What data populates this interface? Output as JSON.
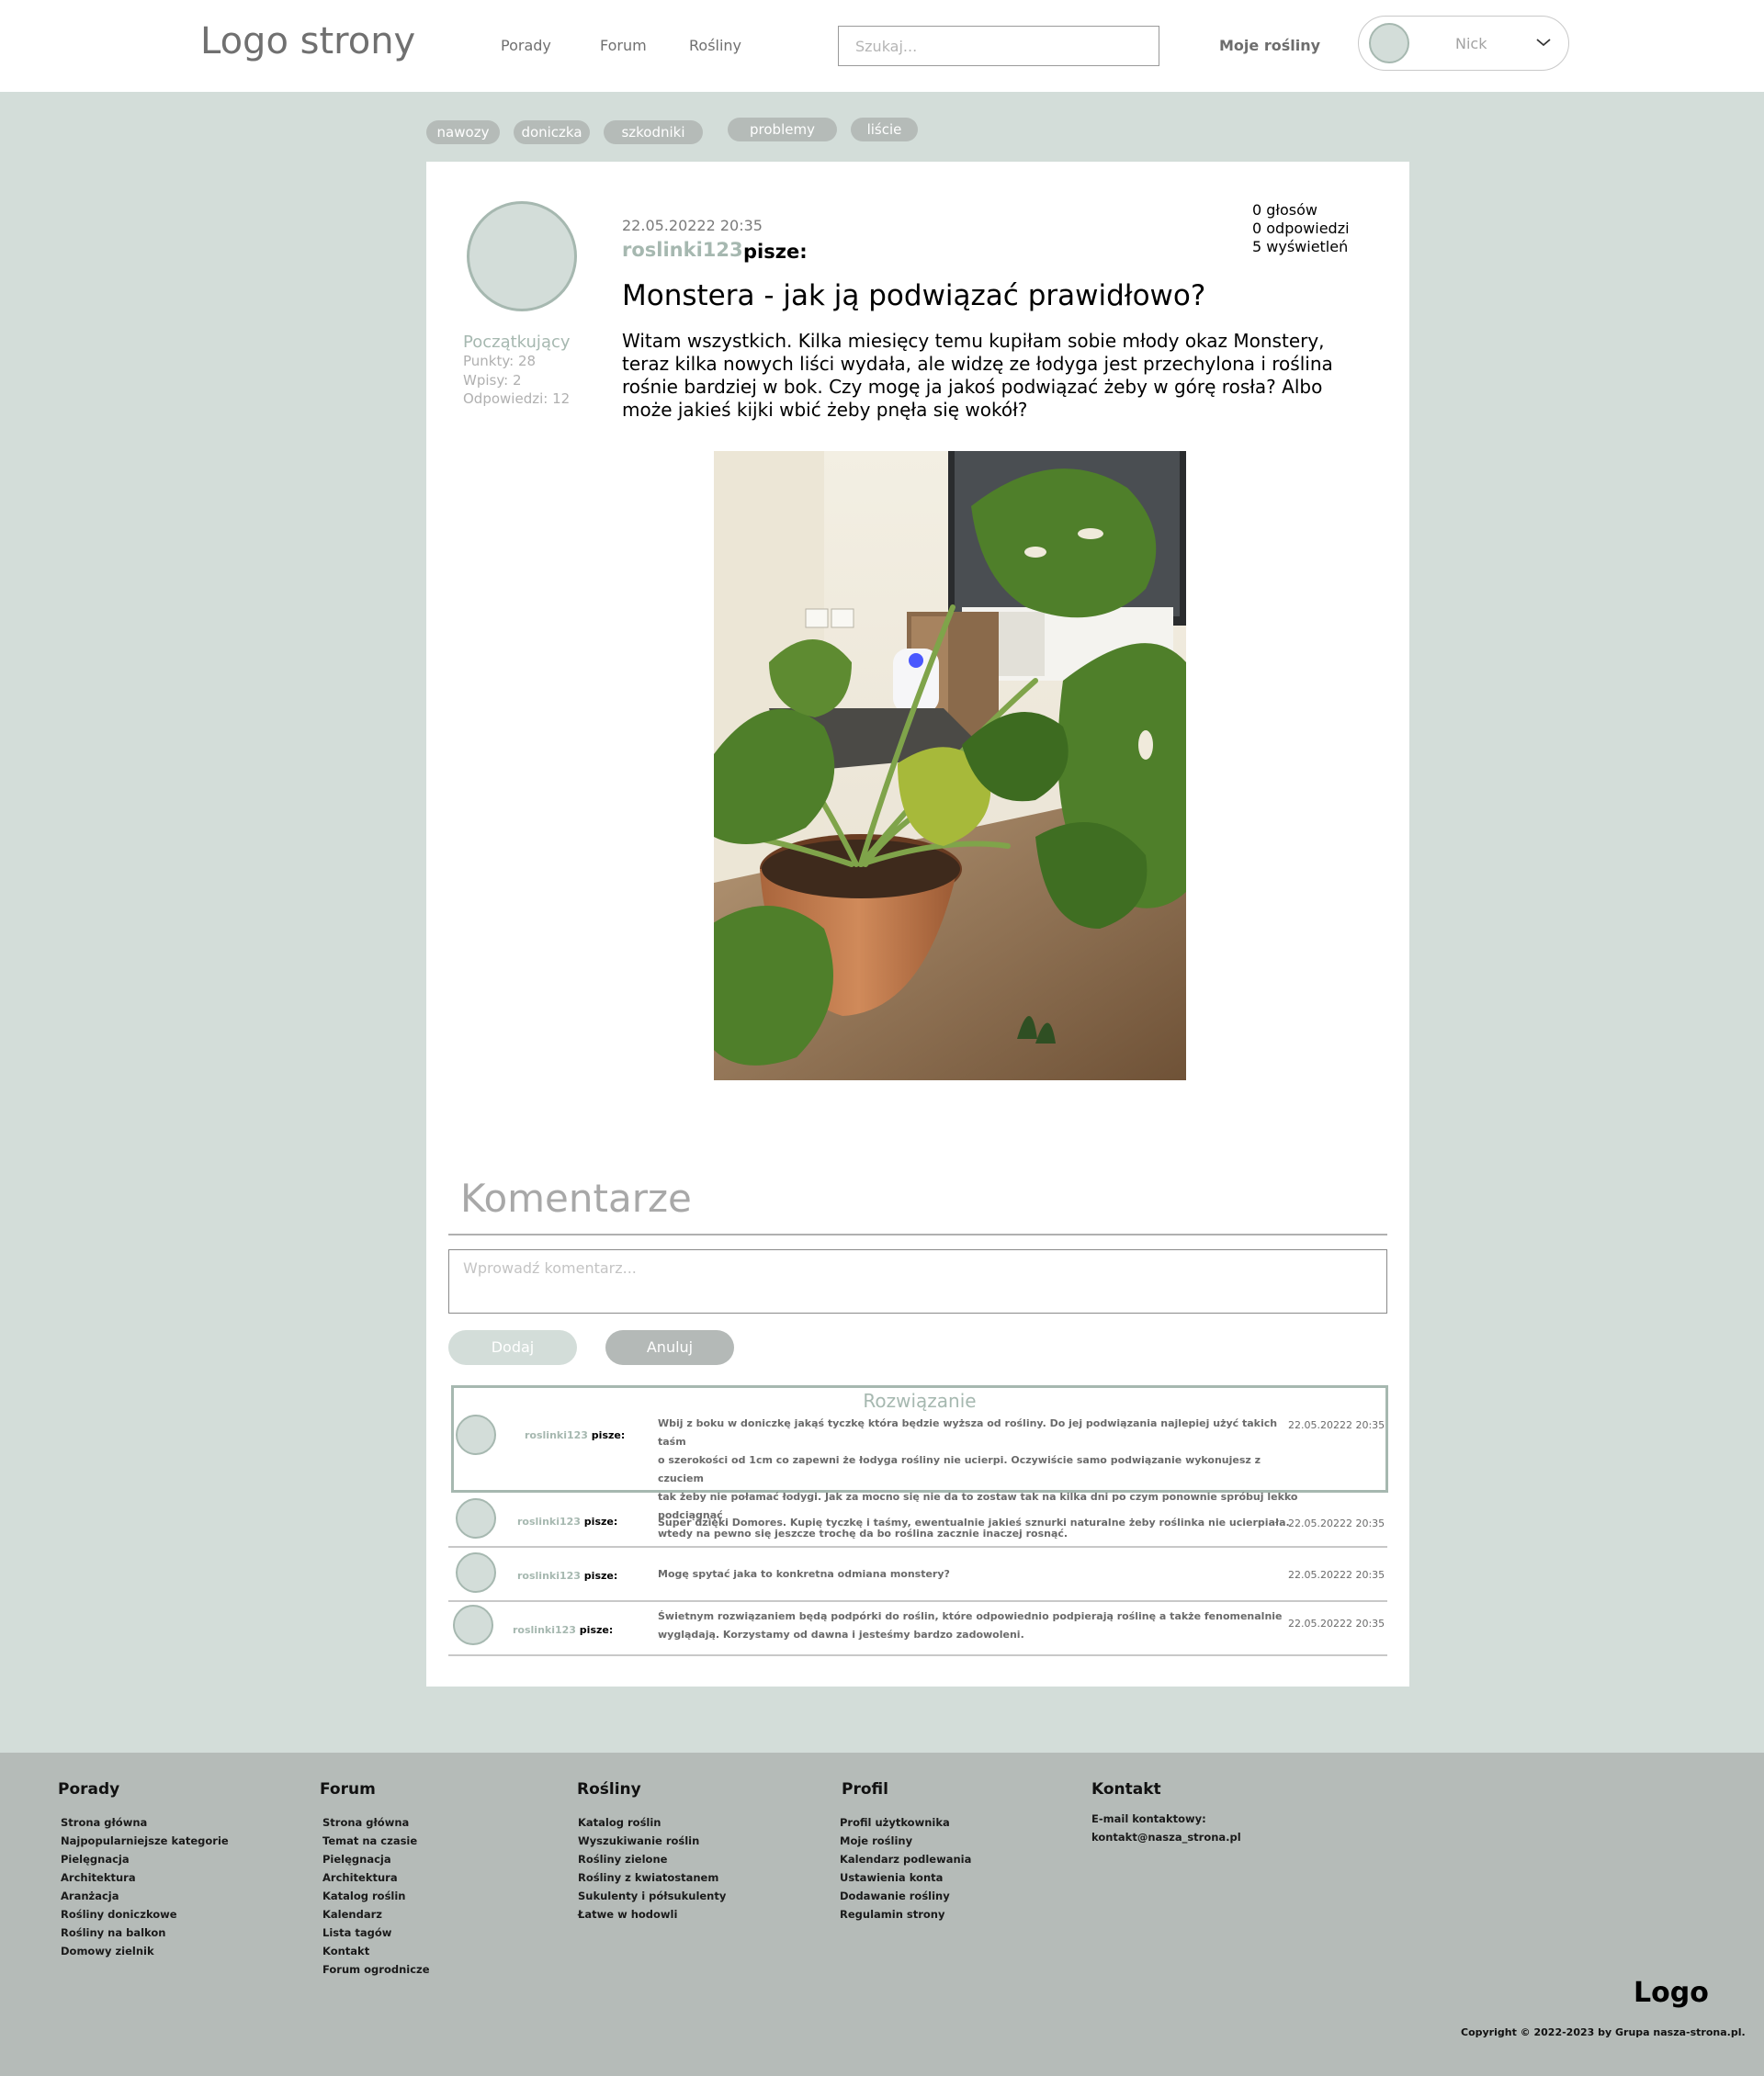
{
  "header": {
    "logo": "Logo strony",
    "nav": [
      "Porady",
      "Forum",
      "Rośliny"
    ],
    "search_placeholder": "Szukaj...",
    "my_plants": "Moje rośliny",
    "nick": "Nick"
  },
  "tags": [
    "nawozy",
    "doniczka",
    "szkodniki",
    "problemy",
    "liście"
  ],
  "author": {
    "rank": "Początkujący",
    "points": "Punkty: 28",
    "entries": "Wpisy: 2",
    "replies": "Odpowiedzi: 12"
  },
  "post": {
    "date": "22.05.20222 20:35",
    "author": "roslinki123",
    "writes": "pisze:",
    "title": "Monstera - jak ją podwiązać prawidłowo?",
    "body_lines": [
      "Witam wszystkich. Kilka miesięcy temu kupiłam sobie młody okaz Monstery,",
      "teraz kilka nowych liści wydała, ale widzę ze łodyga jest przechylona i roślina",
      "rośnie bardziej w bok. Czy mogę ja jakoś podwiązać żeby w górę rosła? Albo",
      "może jakieś kijki wbić żeby pnęła się wokół?"
    ],
    "votes": "0 głosów",
    "answers": "0 odpowiedzi",
    "views": "5 wyświetleń"
  },
  "comments_section": {
    "title": "Komentarze",
    "input_placeholder": "Wprowadź komentarz...",
    "add_label": "Dodaj",
    "cancel_label": "Anuluj",
    "solution_title": "Rozwiązanie"
  },
  "comments": [
    {
      "user": "roslinki123",
      "writes": "pisze:",
      "date": "22.05.20222 20:35",
      "lines": [
        "Wbij z boku w doniczkę jakąś tyczkę która będzie wyższa od rośliny. Do jej podwiązania najlepiej użyć takich taśm",
        "o szerokości od 1cm co zapewni że łodyga rośliny nie ucierpi. Oczywiście samo podwiązanie wykonujesz z czuciem",
        "tak żeby nie połamać łodygi. Jak za mocno się nie da to zostaw tak na kilka dni po czym ponownie spróbuj lekko podciągnąć",
        "wtedy na pewno się jeszcze trochę da bo roślina zacznie inaczej rosnąć."
      ]
    },
    {
      "user": "roslinki123",
      "writes": "pisze:",
      "date": "22.05.20222 20:35",
      "lines": [
        "Super dzięki Domores. Kupię tyczkę i taśmy, ewentualnie jakieś sznurki naturalne żeby roślinka nie ucierpiała."
      ]
    },
    {
      "user": "roslinki123",
      "writes": "pisze:",
      "date": "22.05.20222 20:35",
      "lines": [
        "Mogę spytać jaka to konkretna odmiana monstery?"
      ]
    },
    {
      "user": "roslinki123",
      "writes": "pisze:",
      "date": "22.05.20222 20:35",
      "lines": [
        "Świetnym rozwiązaniem będą podpórki do roślin, które odpowiednio podpierają roślinę a także fenomenalnie",
        "wyglądają. Korzystamy od dawna i jesteśmy bardzo zadowoleni."
      ]
    }
  ],
  "footer": {
    "columns": [
      {
        "title": "Porady",
        "items": [
          "Strona główna",
          "Najpopularniejsze kategorie",
          "Pielęgnacja",
          "Architektura",
          "Aranżacja",
          "Rośliny doniczkowe",
          "Rośliny na balkon",
          "Domowy zielnik"
        ]
      },
      {
        "title": "Forum",
        "items": [
          "Strona główna",
          "Temat na czasie",
          "Pielęgnacja",
          "Architektura",
          "Katalog roślin",
          "Kalendarz",
          "Lista tagów",
          "Kontakt",
          "Forum ogrodnicze"
        ]
      },
      {
        "title": "Rośliny",
        "items": [
          "Katalog roślin",
          "Wyszukiwanie roślin",
          "Rośliny zielone",
          "Rośliny z kwiatostanem",
          "Sukulenty i półsukulenty",
          "Łatwe w hodowli"
        ]
      },
      {
        "title": "Profil",
        "items": [
          "Profil użytkownika",
          "Moje rośliny",
          "Kalendarz podlewania",
          "Ustawienia konta",
          "Dodawanie rośliny",
          "Regulamin strony"
        ]
      }
    ],
    "contact_title": "Kontakt",
    "contact_label": "E-mail kontaktowy:",
    "contact_email": "kontakt@nasza_strona.pl",
    "logo": "Logo",
    "copyright": "Copyright © 2022-2023 by Grupa nasza-strona.pl."
  }
}
